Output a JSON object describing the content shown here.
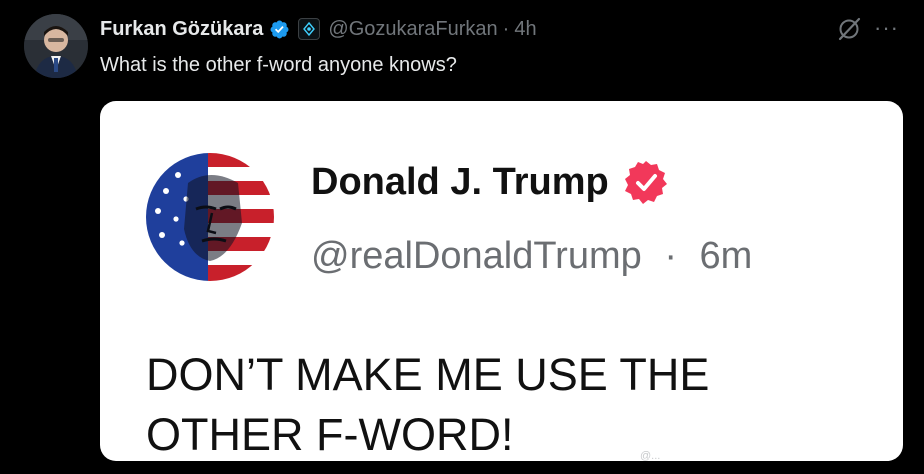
{
  "tweet": {
    "author": {
      "name": "Furkan Gözükara",
      "handle": "@GozukaraFurkan",
      "separator": "·",
      "time": "4h"
    },
    "text": "What is the other f-word anyone knows?",
    "more_label": "···"
  },
  "embedded_post": {
    "author": {
      "name": "Donald J. Trump",
      "handle": "@realDonaldTrump",
      "separator": "·",
      "time": "6m"
    },
    "body_lines": [
      "DON’T MAKE ME USE THE",
      "OTHER F-WORD!"
    ],
    "watermark": "@..."
  },
  "icons": {
    "verified": "verified-badge-icon",
    "affiliate": "affiliate-badge-icon",
    "grok": "grok-icon",
    "more": "more-options-icon",
    "truth_verified": "truth-verified-badge-icon"
  },
  "colors": {
    "background": "#000000",
    "primary_text": "#e7e9ea",
    "secondary_text": "#71767b",
    "verified_blue": "#1d9bf0",
    "truth_badge_red": "#f2385a",
    "card_background": "#ffffff"
  }
}
